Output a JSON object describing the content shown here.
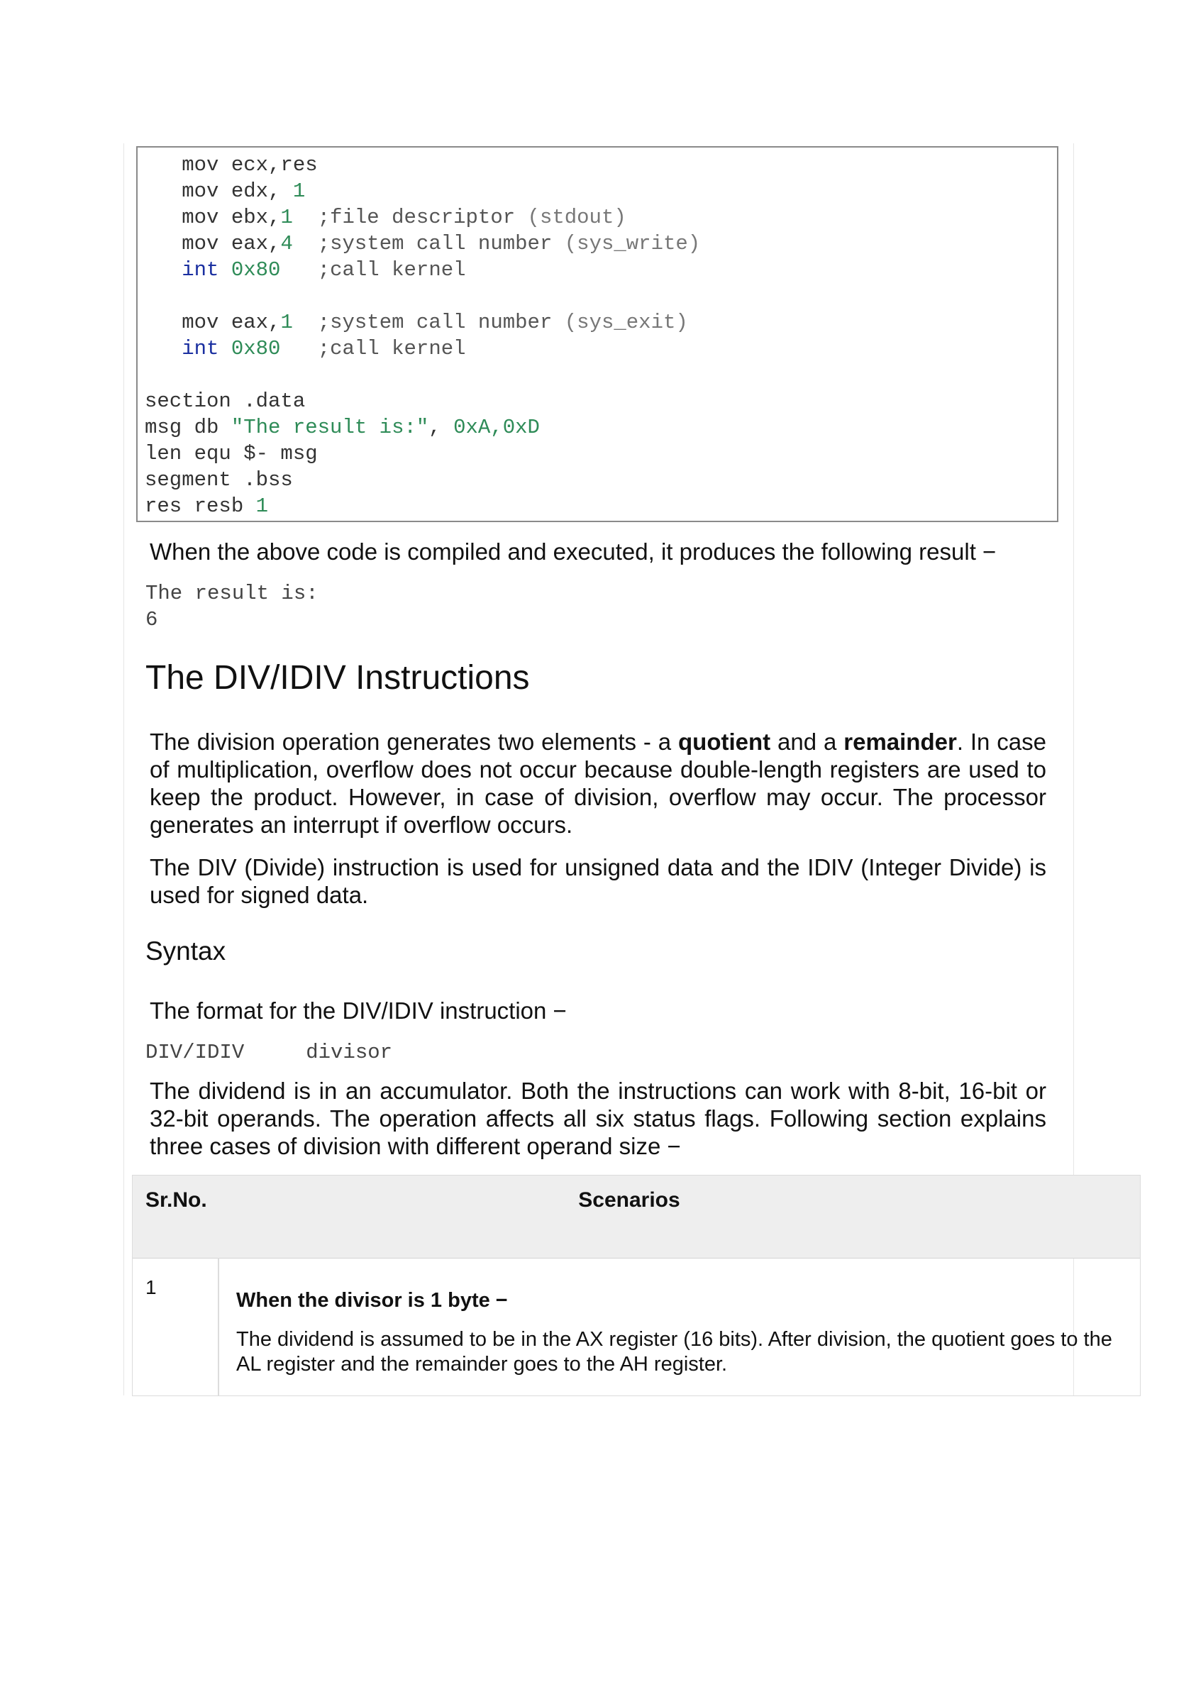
{
  "code": {
    "lines": [
      {
        "indent": true,
        "op": "mov",
        "arg": "ecx,res",
        "num": "",
        "comment": ""
      },
      {
        "indent": true,
        "op": "mov",
        "arg": "edx, ",
        "num": "1",
        "comment": ""
      },
      {
        "indent": true,
        "op": "mov",
        "arg": "ebx,",
        "num": "1",
        "comment": "file descriptor",
        "comment_paren": "(stdout)"
      },
      {
        "indent": true,
        "op": "mov",
        "arg": "eax,",
        "num": "4",
        "comment": "system call number",
        "comment_paren": "(sys_write)"
      },
      {
        "indent": true,
        "op": "int",
        "arg": "",
        "num": "0x80",
        "comment": "call kernel"
      },
      {
        "indent": true,
        "op": "mov",
        "arg": "eax,",
        "num": "1",
        "comment": "system call number",
        "comment_paren": "(sys_exit)"
      },
      {
        "indent": true,
        "op": "int",
        "arg": "",
        "num": "0x80",
        "comment": "call kernel"
      }
    ],
    "data_section": {
      "l1": "section .data",
      "l2_a": "msg db ",
      "l2_str": "\"The result is:\"",
      "l2_sep": ", ",
      "l2_nums": "0xA,0xD",
      "l3": "len equ $- msg",
      "l4": "segment .bss",
      "l5_a": "res resb ",
      "l5_num": "1"
    }
  },
  "intro_result": "When the above code is compiled and executed, it produces the following result −",
  "output": {
    "line1": "The result is:",
    "line2": "6"
  },
  "heading": "The DIV/IDIV Instructions",
  "para1": {
    "a": "The division operation generates two elements - a ",
    "b": "quotient",
    "c": " and a ",
    "d": "remainder",
    "e": ". In case of multiplication, overflow does not occur because double-length registers are used to keep the product. However, in case of division, overflow may occur. The processor generates an interrupt if overflow occurs."
  },
  "para2": "The DIV (Divide) instruction is used for unsigned data and the IDIV (Integer Divide) is used for signed data.",
  "syntax_heading": "Syntax",
  "format_text": "The format for the DIV/IDIV instruction −",
  "syntax_code": "DIV/IDIV     divisor",
  "para3": "The dividend is in an accumulator. Both the instructions can work with 8-bit, 16-bit or 32-bit operands. The operation affects all six status flags. Following section explains three cases of division with different operand size −",
  "table": {
    "headers": [
      "Sr.No.",
      "Scenarios"
    ],
    "rows": [
      {
        "num": "1",
        "title": "When the divisor is 1 byte −",
        "desc": "The dividend is assumed to be in the AX register (16 bits). After division, the quotient goes to the AL register and the remainder goes to the AH register."
      }
    ]
  }
}
